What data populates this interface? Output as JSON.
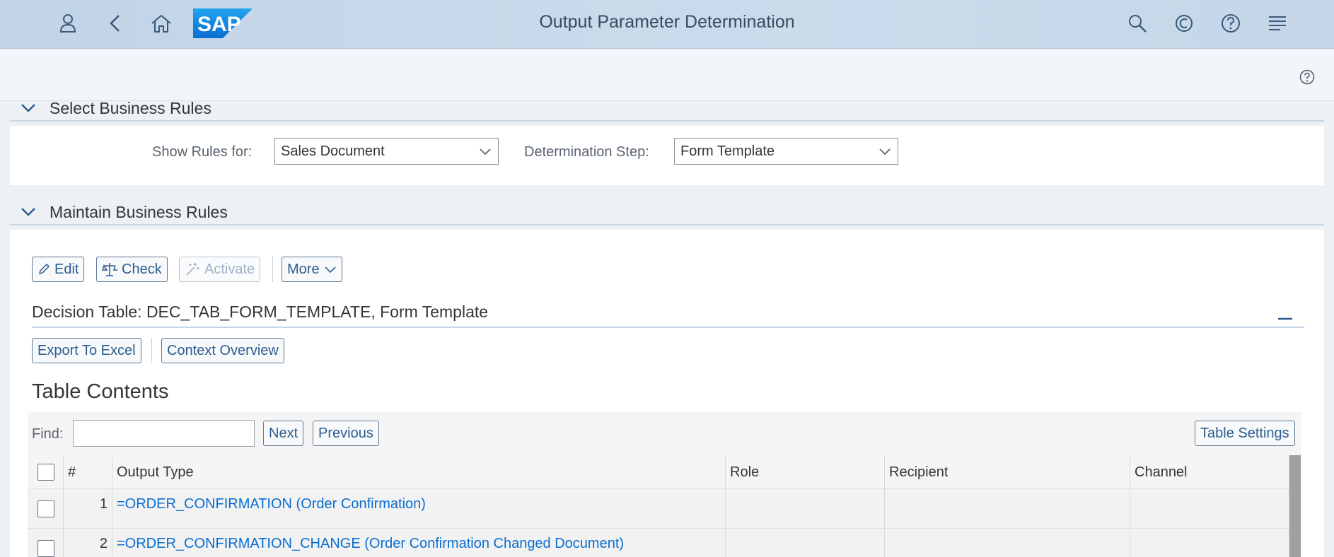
{
  "shell": {
    "title": "Output Parameter Determination",
    "icons": [
      "user-icon",
      "back-icon",
      "home-icon",
      "search-icon",
      "copilot-icon",
      "help-icon",
      "notifications-icon"
    ],
    "logo_text": "SAP"
  },
  "sections": {
    "select": {
      "title": "Select Business Rules",
      "show_rules_label": "Show Rules for:",
      "show_rules_value": "Sales Document",
      "step_label": "Determination Step:",
      "step_value": "Form Template"
    },
    "maintain": {
      "title": "Maintain Business Rules",
      "buttons": {
        "edit": "Edit",
        "check": "Check",
        "activate": "Activate",
        "more": "More"
      },
      "decision_table_title": "Decision Table: DEC_TAB_FORM_TEMPLATE, Form Template",
      "export": "Export To Excel",
      "context": "Context Overview",
      "table_contents_title": "Table Contents",
      "find_label": "Find:",
      "find_value": "",
      "next": "Next",
      "previous": "Previous",
      "table_settings": "Table Settings"
    }
  },
  "table": {
    "columns": [
      "#",
      "Output Type",
      "Role",
      "Recipient",
      "Channel"
    ],
    "rows": [
      {
        "num": "1",
        "output_type": "=ORDER_CONFIRMATION (Order Confirmation)",
        "role": "",
        "recipient": "",
        "channel": ""
      },
      {
        "num": "2",
        "output_type": "=ORDER_CONFIRMATION_CHANGE (Order Confirmation Changed Document)",
        "role": "",
        "recipient": "",
        "channel": ""
      }
    ]
  },
  "colors": {
    "shell_bg": "#c5d6e8",
    "link": "#0a6ed1",
    "button_text": "#2c5d8f",
    "sap_logo": "#1f8ff0"
  }
}
